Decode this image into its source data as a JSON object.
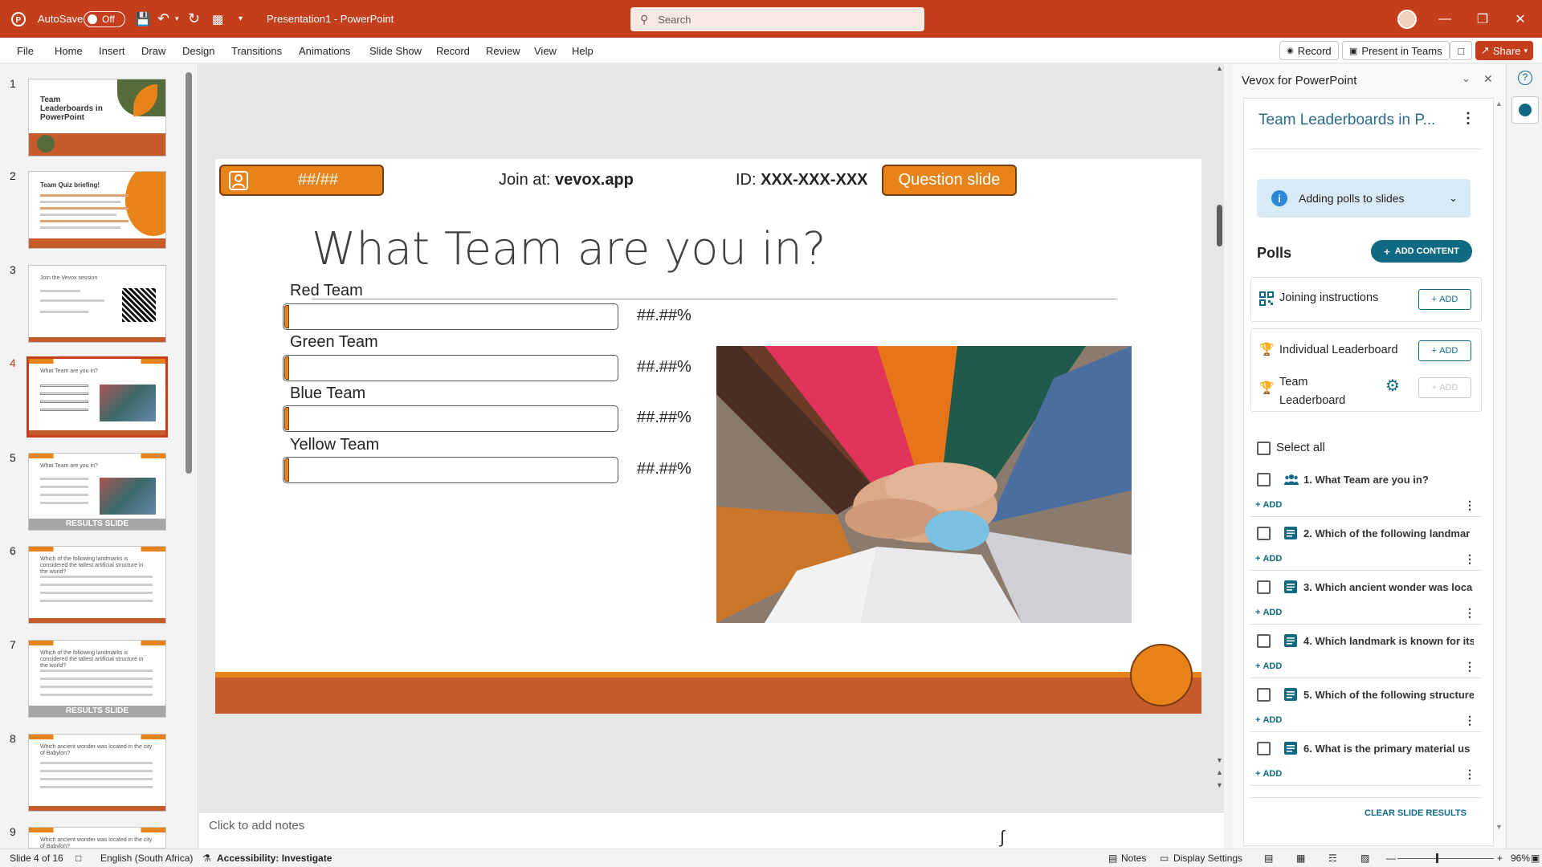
{
  "titlebar": {
    "autosave_label": "AutoSave",
    "autosave_state": "Off",
    "doc_title": "Presentation1  -  PowerPoint",
    "search_placeholder": "Search"
  },
  "menu": {
    "items": [
      "File",
      "Home",
      "Insert",
      "Draw",
      "Design",
      "Transitions",
      "Animations",
      "Slide Show",
      "Record",
      "Review",
      "View",
      "Help"
    ],
    "record_btn": "Record",
    "teams_btn": "Present in Teams",
    "share_btn": "Share"
  },
  "thumbnails": {
    "numbers": [
      "1",
      "2",
      "3",
      "4",
      "5",
      "6",
      "7",
      "8",
      "9"
    ],
    "t1_title": "Team Leaderboards in PowerPoint",
    "t2_title": "Team Quiz briefing!",
    "t3_title": "Join the Vevox session",
    "t4_title": "What Team are you in?",
    "t5_title": "What Team are you in?",
    "t6_title": "Which of the following landmarks is considered the tallest artificial structure in the world?",
    "t7_title": "Which of the following landmarks is considered the tallest artificial structure in the world?",
    "t8_title": "Which ancient wonder was located in the city of Babylon?",
    "t9_title": "Which ancient wonder was located in the city of Babylon?",
    "results_label": "RESULTS SLIDE"
  },
  "slide": {
    "counter": "##/##",
    "join_prefix": "Join at: ",
    "join_url": "vevox.app",
    "id_prefix": "ID: ",
    "id_value": "XXX-XXX-XXX",
    "badge": "Question slide",
    "title": "What Team are you in?",
    "teams": [
      {
        "name": "Red Team",
        "pct": "##.##%"
      },
      {
        "name": "Green Team",
        "pct": "##.##%"
      },
      {
        "name": "Blue Team",
        "pct": "##.##%"
      },
      {
        "name": "Yellow Team",
        "pct": "##.##%"
      }
    ],
    "accent": "#e8831a",
    "band": "#c55a2a"
  },
  "notes_placeholder": "Click to add notes",
  "addin": {
    "title": "Vevox for PowerPoint",
    "presentation": "Team Leaderboards in P...",
    "info": "Adding polls to slides",
    "polls_heading": "Polls",
    "add_content": "ADD CONTENT",
    "joining": "Joining instructions",
    "individual": "Individual Leaderboard",
    "team_lb": "Team Leaderboard",
    "add_label": "ADD",
    "select_all": "Select all",
    "questions": [
      "1. What Team are you in?",
      "2. Which of the following landmar",
      "3. Which ancient wonder was loca",
      "4. Which landmark is known for its",
      "5. Which of the following structure",
      "6. What is the primary material us"
    ],
    "clear": "CLEAR SLIDE RESULTS"
  },
  "status": {
    "slide": "Slide 4 of 16",
    "lang": "English (South Africa)",
    "access": "Accessibility: Investigate",
    "notes": "Notes",
    "display": "Display Settings",
    "zoom": "96%"
  }
}
